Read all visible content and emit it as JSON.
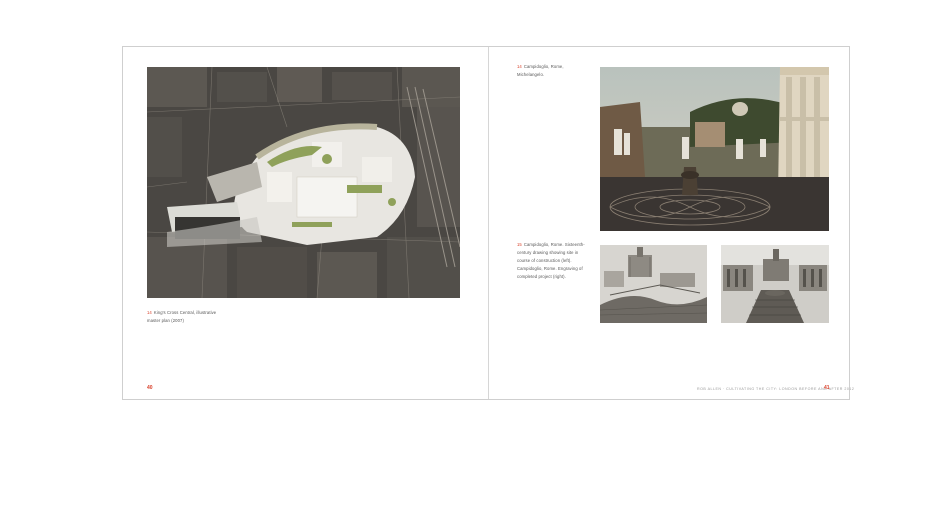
{
  "left_page": {
    "figure": {
      "number": "14",
      "caption_lines": [
        "King's Cross Central, illustrative",
        "master plan (2007)"
      ]
    },
    "page_number": "40"
  },
  "right_page": {
    "figure_top": {
      "number": "14",
      "caption_lines": [
        "Campidoglio, Rome,",
        "Michelangelo."
      ]
    },
    "figure_bottom": {
      "number": "15",
      "caption_lines": [
        "Campidoglio, Rome. Sixteenth-",
        "century drawing showing site in",
        "course of construction (left).",
        "Campidoglio, Rome. Engraving of",
        "completed project (right)."
      ]
    },
    "running_head": "ROB ALLEN · CULTIVATING THE CITY: LONDON BEFORE AND AFTER 2012",
    "page_number": "41"
  }
}
